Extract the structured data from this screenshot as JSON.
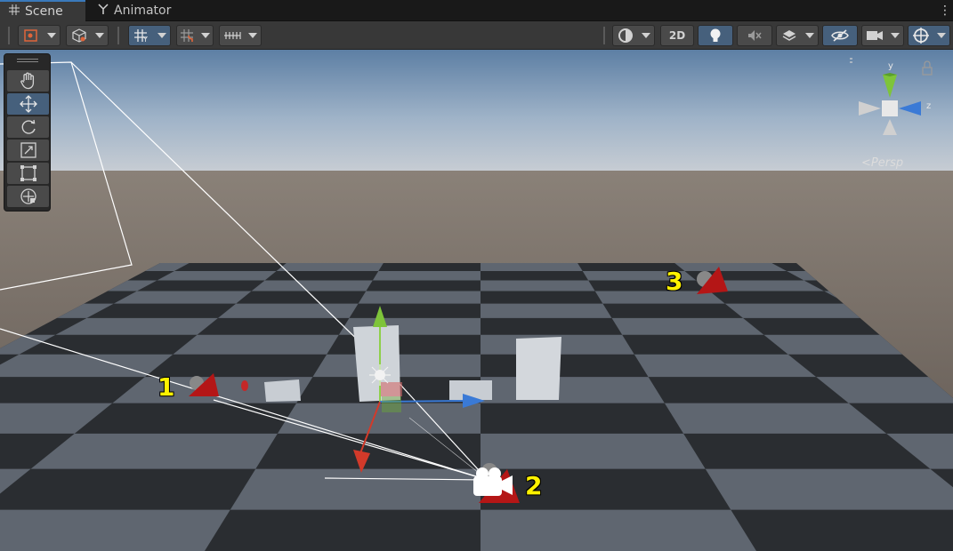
{
  "tabs": [
    {
      "label": "Scene",
      "icon": "grid-icon",
      "active": true
    },
    {
      "label": "Animator",
      "icon": "animator-icon",
      "active": false
    }
  ],
  "toolbar": {
    "toggle_2d": "2D"
  },
  "gizmo": {
    "axis_y": "y",
    "axis_z": "z",
    "projection": "<Persp"
  },
  "annotations": [
    "1",
    "2",
    "3"
  ],
  "colors": {
    "axis_x": "#d23a2a",
    "axis_y": "#7ec43a",
    "axis_z": "#3a7ad6",
    "selection_blue": "#46607c",
    "annotation": "#fff200"
  }
}
